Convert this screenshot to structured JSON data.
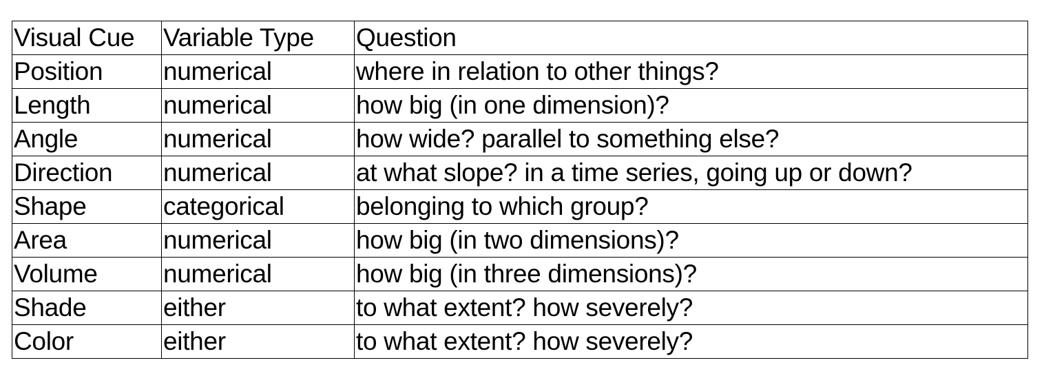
{
  "table": {
    "headers": [
      "Visual Cue",
      "Variable Type",
      "Question"
    ],
    "rows": [
      [
        "Position",
        "numerical",
        "where in relation to other things?"
      ],
      [
        "Length",
        "numerical",
        "how big (in one dimension)?"
      ],
      [
        "Angle",
        "numerical",
        "how wide? parallel to something else?"
      ],
      [
        "Direction",
        "numerical",
        "at what slope? in a time series, going up or down?"
      ],
      [
        "Shape",
        "categorical",
        "belonging to which group?"
      ],
      [
        "Area",
        "numerical",
        "how big (in two dimensions)?"
      ],
      [
        "Volume",
        "numerical",
        "how big (in three dimensions)?"
      ],
      [
        "Shade",
        "either",
        "to what extent? how severely?"
      ],
      [
        "Color",
        "either",
        "to what extent? how severely?"
      ]
    ]
  }
}
